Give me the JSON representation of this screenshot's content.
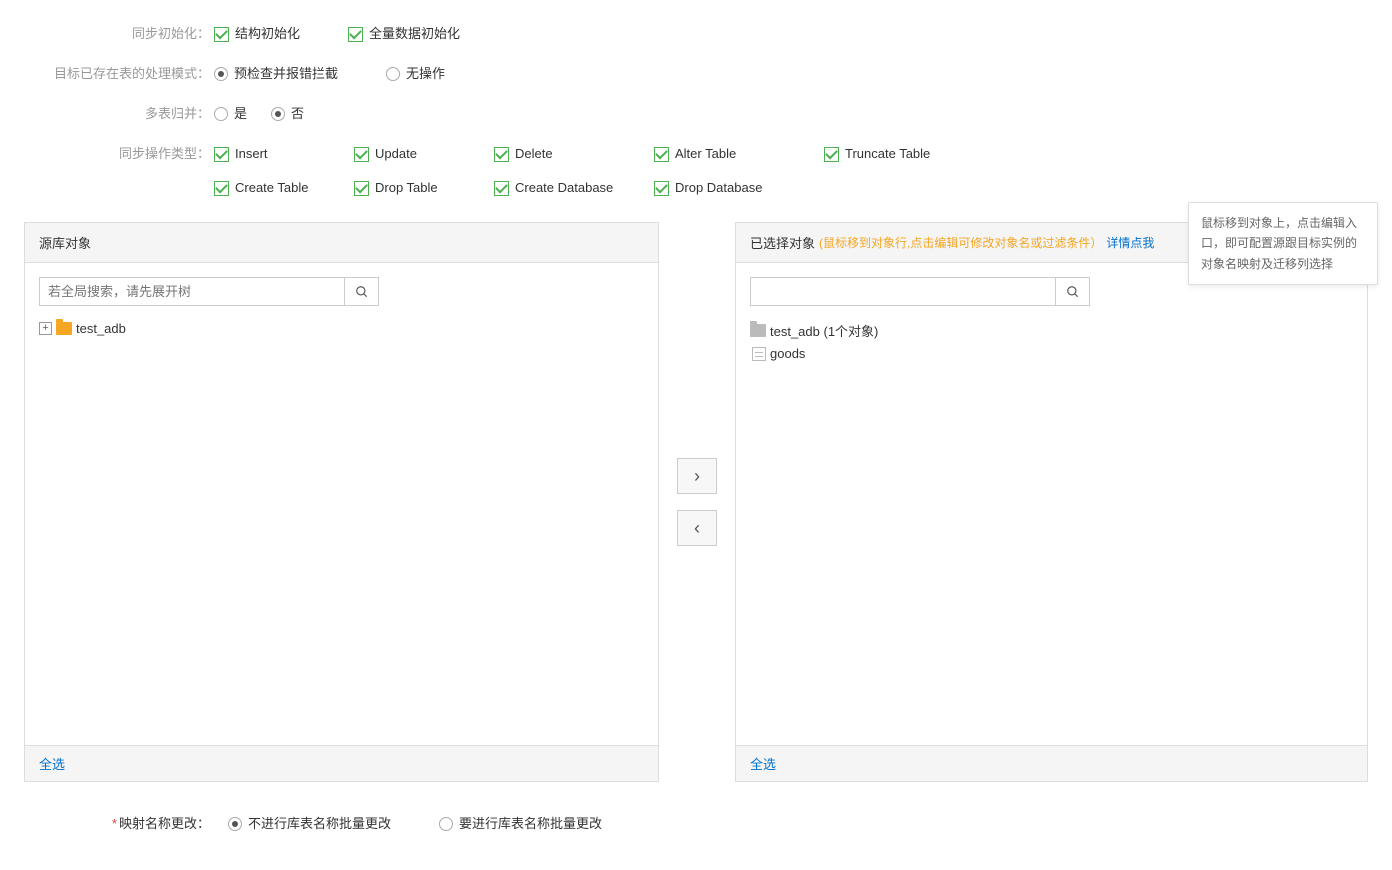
{
  "labels": {
    "sync_init": "同步初始化：",
    "target_mode": "目标已存在表的处理模式：",
    "multi_merge": "多表归并：",
    "sync_op_type": "同步操作类型：",
    "mapping_change": "映射名称更改："
  },
  "sync_init": {
    "struct": "结构初始化",
    "full": "全量数据初始化"
  },
  "target_mode": {
    "precheck": "预检查并报错拦截",
    "noop": "无操作"
  },
  "multi_merge": {
    "yes": "是",
    "no": "否"
  },
  "ops": {
    "insert": "Insert",
    "update": "Update",
    "delete": "Delete",
    "alter": "Alter Table",
    "truncate": "Truncate Table",
    "create_table": "Create Table",
    "drop_table": "Drop Table",
    "create_db": "Create Database",
    "drop_db": "Drop Database"
  },
  "source_panel": {
    "title": "源库对象",
    "search_placeholder": "若全局搜索，请先展开树",
    "items": [
      {
        "name": "test_adb"
      }
    ],
    "select_all": "全选"
  },
  "target_panel": {
    "title": "已选择对象",
    "hint": "(鼠标移到对象行,点击编辑可修改对象名或过滤条件）",
    "link": "详情点我",
    "items_db": "test_adb (1个对象)",
    "items_table": "goods",
    "select_all": "全选"
  },
  "tooltip": "鼠标移到对象上，点击编辑入口，即可配置源跟目标实例的对象名映射及迁移列选择",
  "mapping": {
    "no_batch": "不进行库表名称批量更改",
    "do_batch": "要进行库表名称批量更改"
  }
}
